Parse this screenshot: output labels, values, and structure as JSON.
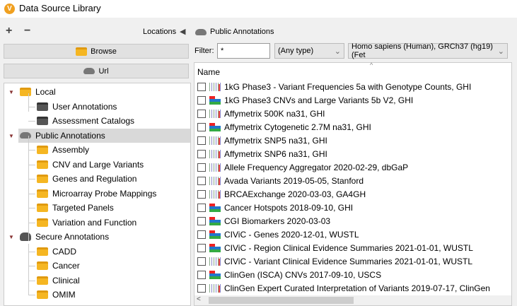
{
  "window": {
    "title": "Data Source Library"
  },
  "toolbar": {
    "add": "+",
    "remove": "−",
    "locations": "Locations",
    "collapse_arrow": "◀",
    "current_location": "Public Annotations"
  },
  "left": {
    "browse": "Browse",
    "url": "Url"
  },
  "tree": [
    {
      "label": "Local",
      "level": 0,
      "icon": "folder-icon",
      "expanded": true
    },
    {
      "label": "User Annotations",
      "level": 1,
      "icon": "dark-folder-icon"
    },
    {
      "label": "Assessment Catalogs",
      "level": 1,
      "icon": "dark-folder-icon"
    },
    {
      "label": "Public Annotations",
      "level": 0,
      "icon": "cloud-icon",
      "expanded": true,
      "selected": true
    },
    {
      "label": "Assembly",
      "level": 1,
      "icon": "folder-icon"
    },
    {
      "label": "CNV and Large Variants",
      "level": 1,
      "icon": "folder-icon"
    },
    {
      "label": "Genes and Regulation",
      "level": 1,
      "icon": "folder-icon"
    },
    {
      "label": "Microarray Probe Mappings",
      "level": 1,
      "icon": "folder-icon"
    },
    {
      "label": "Targeted Panels",
      "level": 1,
      "icon": "folder-icon"
    },
    {
      "label": "Variation and Function",
      "level": 1,
      "icon": "folder-icon"
    },
    {
      "label": "Secure Annotations",
      "level": 0,
      "icon": "lock-cloud-icon",
      "expanded": true
    },
    {
      "label": "CADD",
      "level": 1,
      "icon": "folder-icon"
    },
    {
      "label": "Cancer",
      "level": 1,
      "icon": "folder-icon"
    },
    {
      "label": "Clinical",
      "level": 1,
      "icon": "folder-icon"
    },
    {
      "label": "OMIM",
      "level": 1,
      "icon": "folder-icon"
    }
  ],
  "filter": {
    "label": "Filter:",
    "value": "*",
    "type": "(Any type)",
    "genome": "Homo sapiens (Human), GRCh37 (hg19) (Fet"
  },
  "list": {
    "header": "Name",
    "items": [
      {
        "name": "1kG Phase3 - Variant Frequencies 5a with Genotype Counts, GHI",
        "icon": "bars"
      },
      {
        "name": "1kG Phase3 CNVs and Large Variants 5b V2, GHI",
        "icon": "track"
      },
      {
        "name": "Affymetrix 500K na31, GHI",
        "icon": "bars"
      },
      {
        "name": "Affymetrix Cytogenetic 2.7M na31, GHI",
        "icon": "track"
      },
      {
        "name": "Affymetrix SNP5 na31, GHI",
        "icon": "bars"
      },
      {
        "name": "Affymetrix SNP6 na31, GHI",
        "icon": "bars"
      },
      {
        "name": "Allele Frequency Aggregator 2020-02-29, dbGaP",
        "icon": "bars"
      },
      {
        "name": "Avada Variants 2019-05-05, Stanford",
        "icon": "bars"
      },
      {
        "name": "BRCAExchange 2020-03-03, GA4GH",
        "icon": "bars"
      },
      {
        "name": "Cancer Hotspots 2018-09-10, GHI",
        "icon": "track"
      },
      {
        "name": "CGI Biomarkers 2020-03-03",
        "icon": "track"
      },
      {
        "name": "CIViC - Genes 2020-12-01, WUSTL",
        "icon": "track"
      },
      {
        "name": "CIViC - Region Clinical Evidence Summaries 2021-01-01, WUSTL",
        "icon": "track"
      },
      {
        "name": "CIViC - Variant Clinical Evidence Summaries 2021-01-01, WUSTL",
        "icon": "bars"
      },
      {
        "name": "ClinGen (ISCA) CNVs 2017-09-10, USCS",
        "icon": "track"
      },
      {
        "name": "ClinGen Expert Curated Interpretation of Variants 2019-07-17, ClinGen",
        "icon": "bars"
      }
    ]
  }
}
